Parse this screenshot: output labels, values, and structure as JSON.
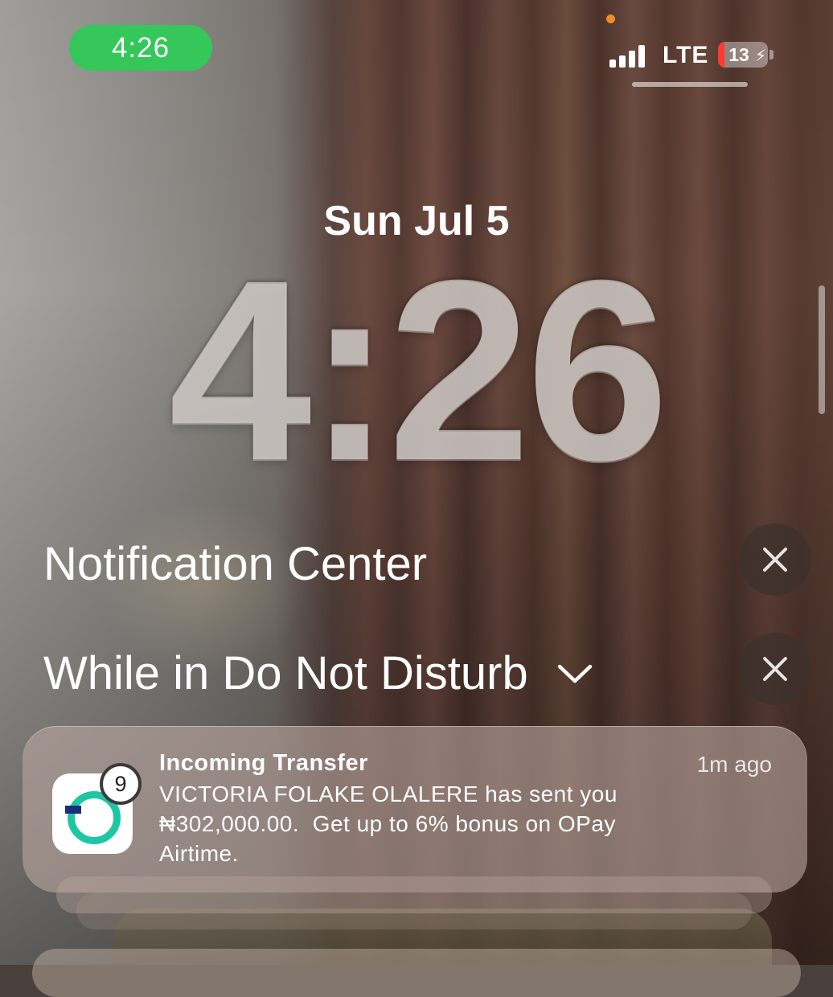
{
  "status_bar": {
    "time": "4:26",
    "network": "LTE",
    "battery_level": "13",
    "battery_fraction": 0.13,
    "battery_charging_icon": "bolt-icon",
    "pill_color": "#35c759",
    "privacy_indicator_color": "#f08a2a"
  },
  "lock_screen": {
    "date": "Sun Jul 5",
    "time": "4:26"
  },
  "notification_center": {
    "title": "Notification Center",
    "focus_section": "While in Do Not Disturb"
  },
  "notification": {
    "app_icon": "opay-icon",
    "badge_count": "9",
    "title": "Incoming Transfer",
    "time": "1m ago",
    "body": "VICTORIA FOLAKE OLALERE has sent you\n₦302,000.00.  Get up to 6% bonus on OPay\nAirtime."
  }
}
